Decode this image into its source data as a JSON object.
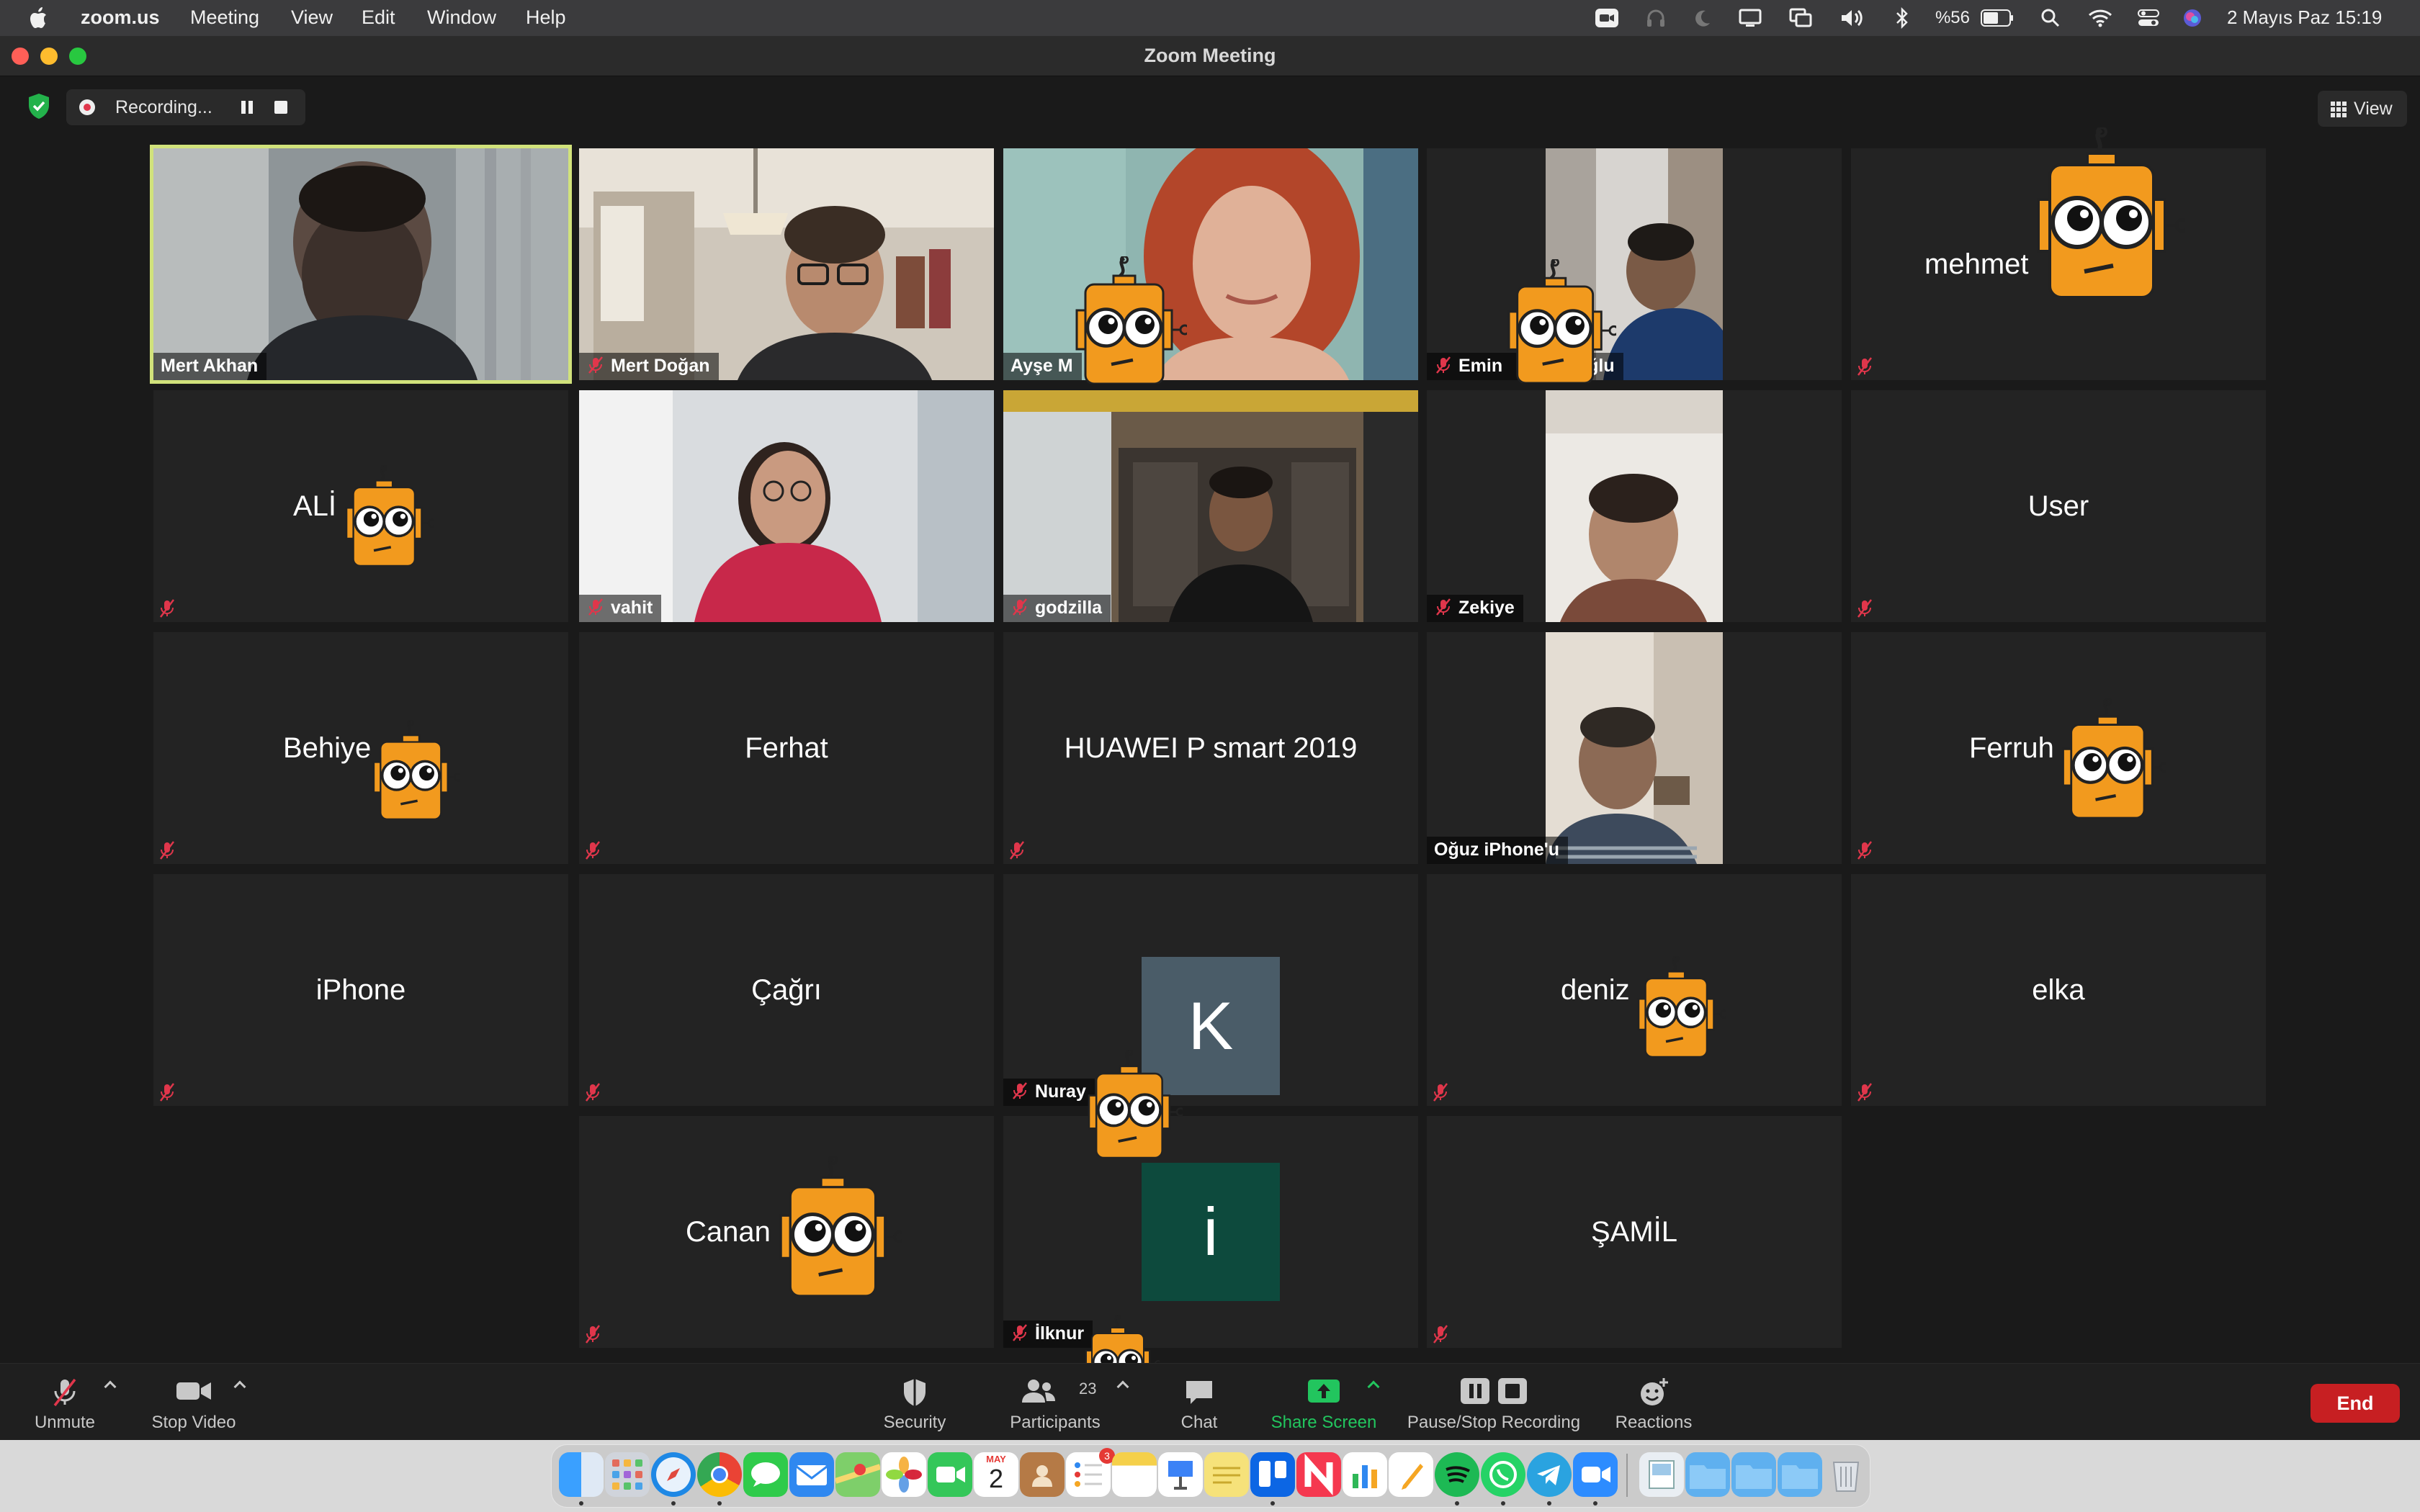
{
  "menubar": {
    "app_name": "zoom.us",
    "menus": [
      "Meeting",
      "View",
      "Edit",
      "Window",
      "Help"
    ],
    "battery": "%56",
    "datetime": "2 Mayıs Paz  15:19",
    "status_icons": [
      "zoom-icon",
      "headphones-icon",
      "moon-icon",
      "display-icon",
      "screen-mirror-icon",
      "volume-icon",
      "bluetooth-icon",
      "battery-icon",
      "search-icon",
      "wifi-icon",
      "control-center-icon",
      "siri-icon"
    ]
  },
  "window": {
    "title": "Zoom Meeting"
  },
  "topbar": {
    "recording_label": "Recording...",
    "view_label": "View"
  },
  "tiles": [
    {
      "name": "Mert Akhan",
      "type": "video",
      "muted": false,
      "active": true
    },
    {
      "name": "Mert Doğan",
      "type": "video",
      "muted": true
    },
    {
      "name": "Ayşe M",
      "type": "video",
      "muted": false
    },
    {
      "name": "Emin",
      "name_suffix": "ğlu",
      "type": "video",
      "muted": true
    },
    {
      "name": "mehmet",
      "type": "name",
      "muted": true
    },
    {
      "name": "ALİ",
      "type": "name",
      "muted": true
    },
    {
      "name": "vahit",
      "type": "video",
      "muted": true
    },
    {
      "name": "godzilla",
      "type": "video",
      "muted": true
    },
    {
      "name": "Zekiye",
      "type": "phone-video",
      "muted": true
    },
    {
      "name": "User",
      "type": "name",
      "muted": true
    },
    {
      "name": "Behiye",
      "type": "name",
      "muted": true
    },
    {
      "name": "Ferhat",
      "type": "name",
      "muted": true
    },
    {
      "name": "HUAWEI P smart 2019",
      "type": "name",
      "muted": true
    },
    {
      "name": "Oğuz iPhone'u",
      "type": "phone-video",
      "muted": false
    },
    {
      "name": "Ferruh",
      "type": "name",
      "muted": true
    },
    {
      "name": "iPhone",
      "type": "name",
      "muted": true
    },
    {
      "name": "Çağrı",
      "type": "name",
      "muted": true
    },
    {
      "name": "Nuray",
      "type": "avatar",
      "avatar_letter": "K",
      "avatar_color": "#4a5c68",
      "muted": true
    },
    {
      "name": "deniz",
      "type": "name",
      "muted": true
    },
    {
      "name": "elka",
      "type": "name",
      "muted": true
    },
    {
      "name": "Canan",
      "type": "name",
      "muted": true
    },
    {
      "name": "İlknur",
      "type": "avatar",
      "avatar_letter": "i",
      "avatar_color": "#0d4a3d",
      "muted": true
    },
    {
      "name": "ŞAMİL",
      "type": "name",
      "muted": true
    }
  ],
  "toolbar": {
    "unmute": "Unmute",
    "stop_video": "Stop Video",
    "security": "Security",
    "participants": "Participants",
    "participants_count": "23",
    "chat": "Chat",
    "share_screen": "Share Screen",
    "pause_stop_recording": "Pause/Stop Recording",
    "reactions": "Reactions",
    "end": "End"
  },
  "dock": {
    "calendar_month": "MAY",
    "calendar_day": "2",
    "reminders_badge": "3",
    "apps": [
      "finder-icon",
      "launchpad-icon",
      "safari-icon",
      "chrome-icon",
      "messages-icon",
      "mail-icon",
      "maps-icon",
      "photos-icon",
      "facetime-icon",
      "calendar-icon",
      "contacts-icon",
      "reminders-icon",
      "notes-icon",
      "keynote-icon",
      "stickies-icon",
      "trello-icon",
      "news-icon",
      "numbers-icon",
      "pages-icon",
      "spotify-icon",
      "whatsapp-icon",
      "telegram-icon",
      "zoom-icon",
      "preview-icon",
      "folder-icon",
      "folder-icon",
      "folder-icon",
      "trash-icon"
    ]
  },
  "colors": {
    "active_speaker": "#d1e27b",
    "end_button": "#c71f22",
    "share_screen": "#22c55e",
    "mascot": "#f29a1e",
    "muted_icon": "#e0364b"
  }
}
